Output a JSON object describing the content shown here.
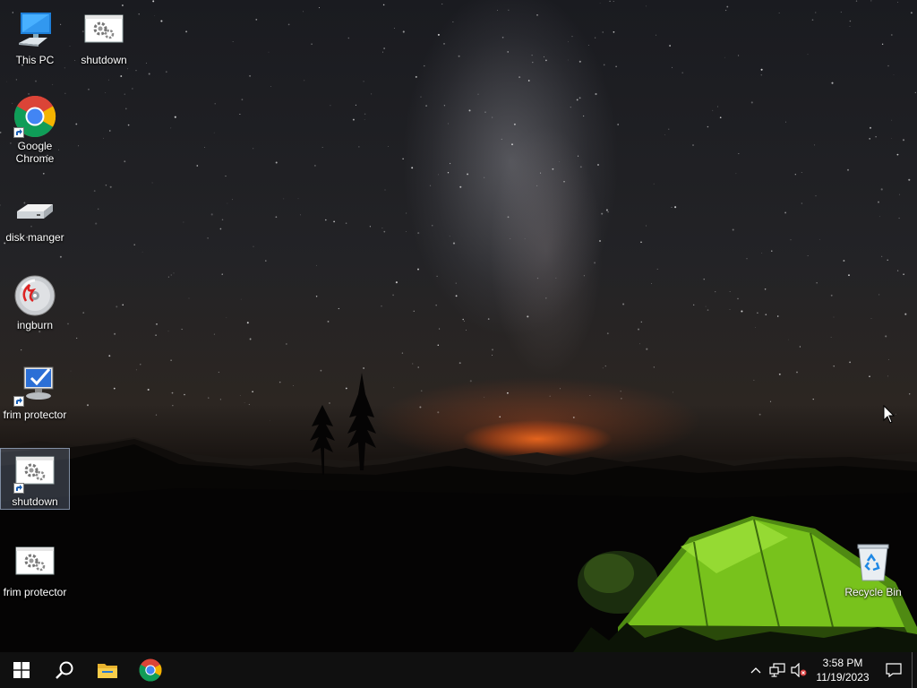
{
  "desktop": {
    "icons": [
      {
        "label": "This PC",
        "icon": "this-pc-icon",
        "shortcut": false
      },
      {
        "label": "shutdown",
        "icon": "gear-document-icon",
        "shortcut": false
      },
      {
        "label": "Google Chrome",
        "icon": "chrome-icon",
        "shortcut": true
      },
      {
        "label": "disk manger",
        "icon": "hard-drive-icon",
        "shortcut": false
      },
      {
        "label": "ingburn",
        "icon": "disc-burn-icon",
        "shortcut": false
      },
      {
        "label": "frim protector",
        "icon": "monitor-check-icon",
        "shortcut": true
      },
      {
        "label": "shutdown",
        "icon": "gear-document-icon",
        "shortcut": true,
        "selected": true
      },
      {
        "label": "frim protector",
        "icon": "gear-document-icon",
        "shortcut": false
      },
      {
        "label": "Recycle Bin",
        "icon": "recycle-bin-icon",
        "shortcut": false
      }
    ]
  },
  "taskbar": {
    "start": "windows-start-icon",
    "search": "search-icon",
    "pinned": [
      {
        "name": "File Explorer",
        "icon": "folder-icon"
      },
      {
        "name": "Google Chrome",
        "icon": "chrome-icon"
      }
    ],
    "tray": {
      "overflow": "chevron-up-icon",
      "network": "network-icon",
      "volume": "volume-muted-icon"
    },
    "clock": {
      "time": "3:58 PM",
      "date": "11/19/2023"
    },
    "notifications": "action-center-icon"
  },
  "colors": {
    "taskbar": "#101010",
    "tent": "#7ec81e",
    "glow": "#ff6a1a",
    "selection": "#96aac8"
  }
}
